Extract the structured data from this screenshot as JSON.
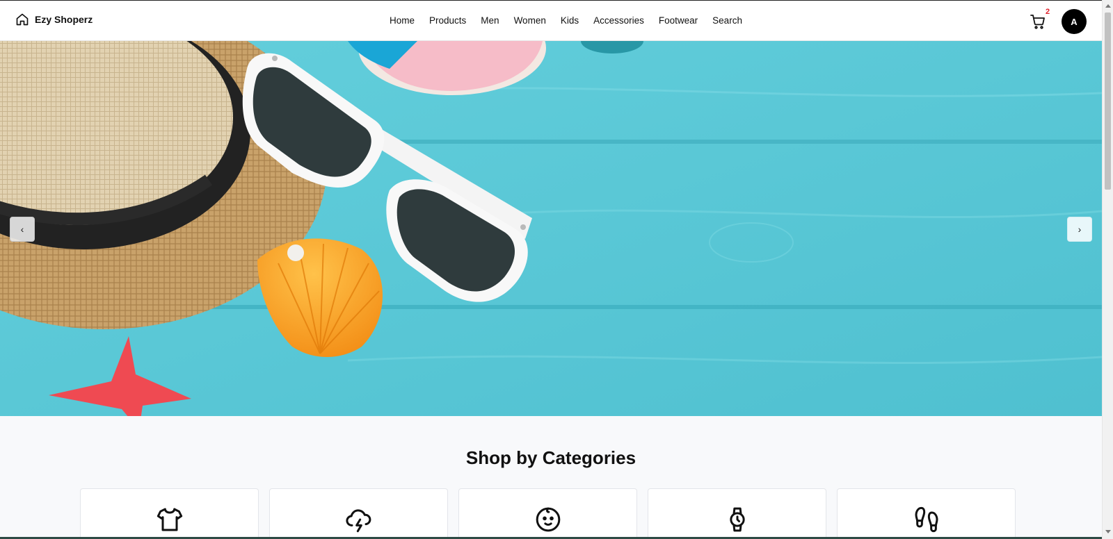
{
  "brand": {
    "name": "Ezy Shoperz",
    "icon": "home-icon"
  },
  "nav": {
    "items": [
      "Home",
      "Products",
      "Men",
      "Women",
      "Kids",
      "Accessories",
      "Footwear",
      "Search"
    ]
  },
  "cart": {
    "icon": "cart-icon",
    "count": "2"
  },
  "user": {
    "avatar_initial": "A"
  },
  "hero": {
    "prev_arrow": "‹",
    "next_arrow": "›",
    "image": "summer-beach-accessories-banner"
  },
  "categories": {
    "title": "Shop by Categories",
    "items": [
      {
        "icon": "tshirt-icon"
      },
      {
        "icon": "cloud-lightning-icon"
      },
      {
        "icon": "baby-face-icon"
      },
      {
        "icon": "watch-icon"
      },
      {
        "icon": "footprints-icon"
      }
    ]
  },
  "colors": {
    "hero_background": "#5cc8d6",
    "badge": "#e0202a",
    "avatar": "#000000"
  }
}
